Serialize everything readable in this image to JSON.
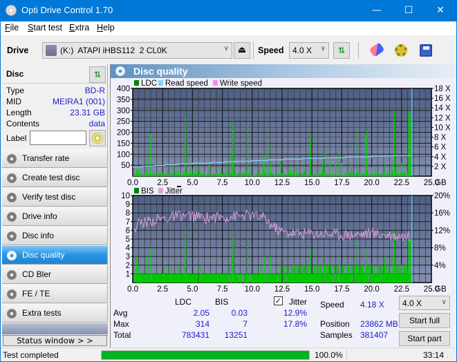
{
  "window": {
    "title": "Opti Drive Control 1.70",
    "minimize_label": "—",
    "maximize_label": "☐",
    "close_label": "✕"
  },
  "menu": {
    "items": [
      {
        "label": "File",
        "accel": "F",
        "rest": "ile"
      },
      {
        "label": "Start test",
        "accel": "S",
        "rest": "tart test"
      },
      {
        "label": "Extra",
        "accel": "E",
        "rest": "xtra"
      },
      {
        "label": "Help",
        "accel": "H",
        "rest": "elp"
      }
    ]
  },
  "toolbar": {
    "drive_label": "Drive",
    "drive_value": "(K:)  ATAPI iHBS112  2 CL0K",
    "speed_label": "Speed",
    "speed_value": "4.0 X",
    "icons": [
      "drive-icon",
      "eject-icon",
      "refresh-icon",
      "erase-icon",
      "settings-icon",
      "save-icon"
    ]
  },
  "disc": {
    "header": "Disc",
    "rows": [
      {
        "label": "Type",
        "value": "BD-R"
      },
      {
        "label": "MID",
        "value": "MEIRA1 (001)"
      },
      {
        "label": "Length",
        "value": "23.31 GB"
      },
      {
        "label": "Contents",
        "value": "data"
      }
    ],
    "label_field_label": "Label",
    "label_value": ""
  },
  "nav": {
    "items": [
      {
        "label": "Transfer rate",
        "active": false
      },
      {
        "label": "Create test disc",
        "active": false
      },
      {
        "label": "Verify test disc",
        "active": false
      },
      {
        "label": "Drive info",
        "active": false
      },
      {
        "label": "Disc info",
        "active": false
      },
      {
        "label": "Disc quality",
        "active": true
      },
      {
        "label": "CD Bler",
        "active": false
      },
      {
        "label": "FE / TE",
        "active": false
      },
      {
        "label": "Extra tests",
        "active": false
      }
    ],
    "status_window_label": "Status window > >"
  },
  "panel": {
    "title": "Disc quality"
  },
  "chart_data": [
    {
      "type": "bar",
      "title": "LDC / Read speed",
      "legend": [
        "LDC",
        "Read speed",
        "Write speed"
      ],
      "legend_colors": [
        "#008000",
        "#87cefa",
        "#ff88ee"
      ],
      "legend_placement": "top-left",
      "x_ticks": [
        "0.0",
        "2.5",
        "5.0",
        "7.5",
        "10.0",
        "12.5",
        "15.0",
        "17.5",
        "20.0",
        "22.5",
        "25.0"
      ],
      "x_unit": "GB",
      "xlim": [
        0,
        25
      ],
      "y_left_ticks": [
        "50",
        "100",
        "150",
        "200",
        "250",
        "300",
        "350",
        "400"
      ],
      "ylim_left": [
        0,
        400
      ],
      "y_right_ticks": [
        "2 X",
        "4 X",
        "6 X",
        "8 X",
        "10 X",
        "12 X",
        "14 X",
        "16 X",
        "18 X"
      ],
      "ylim_right": [
        0,
        18
      ],
      "grid": true,
      "end_marker_x": 23.31,
      "ldc_spikes": [
        [
          0.3,
          30
        ],
        [
          0.5,
          40
        ],
        [
          1.2,
          88
        ],
        [
          1.5,
          195
        ],
        [
          1.7,
          28
        ],
        [
          2.6,
          20
        ],
        [
          2.9,
          45
        ],
        [
          3.1,
          50
        ],
        [
          3.4,
          55
        ],
        [
          3.8,
          30
        ],
        [
          4.4,
          170
        ],
        [
          4.45,
          270
        ],
        [
          4.8,
          35
        ],
        [
          5.3,
          50
        ],
        [
          5.7,
          20
        ],
        [
          6.4,
          55
        ],
        [
          7.4,
          40
        ],
        [
          7.8,
          55
        ],
        [
          8.1,
          90
        ],
        [
          8.3,
          100
        ],
        [
          8.4,
          240
        ],
        [
          8.45,
          250
        ],
        [
          9.6,
          240
        ],
        [
          9.8,
          40
        ],
        [
          10.6,
          60
        ],
        [
          10.9,
          50
        ],
        [
          11.0,
          100
        ],
        [
          11.3,
          175
        ],
        [
          11.5,
          60
        ],
        [
          12.4,
          70
        ],
        [
          13.2,
          40
        ],
        [
          13.7,
          45
        ],
        [
          14.8,
          70
        ],
        [
          14.9,
          190
        ],
        [
          15.3,
          40
        ],
        [
          15.9,
          60
        ],
        [
          16.1,
          125
        ],
        [
          16.5,
          80
        ],
        [
          17.0,
          95
        ],
        [
          17.3,
          100
        ],
        [
          17.5,
          60
        ],
        [
          18.3,
          60
        ],
        [
          18.8,
          200
        ],
        [
          19.5,
          190
        ],
        [
          19.6,
          210
        ],
        [
          20.0,
          40
        ],
        [
          20.3,
          40
        ],
        [
          21.1,
          50
        ],
        [
          21.7,
          60
        ],
        [
          21.9,
          300
        ],
        [
          22.2,
          60
        ],
        [
          22.5,
          60
        ],
        [
          22.8,
          60
        ],
        [
          23.1,
          300
        ],
        [
          23.2,
          290
        ],
        [
          23.25,
          270
        ]
      ],
      "ldc_baseline": 8,
      "read_speed_steps": [
        [
          0,
          1.9
        ],
        [
          0.8,
          2.05
        ],
        [
          1.8,
          2.2
        ],
        [
          2.7,
          2.35
        ],
        [
          3.8,
          2.5
        ],
        [
          5.0,
          2.65
        ],
        [
          6.5,
          2.8
        ],
        [
          7.7,
          2.95
        ],
        [
          8.5,
          3.05
        ],
        [
          10.0,
          3.2
        ],
        [
          11.3,
          3.35
        ],
        [
          12.6,
          3.5
        ],
        [
          14.2,
          3.65
        ],
        [
          16.0,
          3.8
        ],
        [
          17.8,
          3.95
        ],
        [
          20.0,
          4.1
        ],
        [
          21.8,
          4.18
        ],
        [
          23.31,
          4.18
        ]
      ]
    },
    {
      "type": "bar",
      "title": "BIS / Jitter",
      "legend": [
        "BIS",
        "Jitter"
      ],
      "legend_colors": [
        "#008000",
        "#dda0dd"
      ],
      "legend_placement": "top-left",
      "x_ticks": [
        "0.0",
        "2.5",
        "5.0",
        "7.5",
        "10.0",
        "12.5",
        "15.0",
        "17.5",
        "20.0",
        "22.5",
        "25.0"
      ],
      "x_unit": "GB",
      "xlim": [
        0,
        25
      ],
      "y_left_ticks": [
        "1",
        "2",
        "3",
        "4",
        "5",
        "6",
        "7",
        "8",
        "9",
        "10"
      ],
      "ylim_left": [
        0,
        10
      ],
      "y_right_ticks": [
        "4%",
        "8%",
        "12%",
        "16%",
        "20%"
      ],
      "ylim_right": [
        0,
        20
      ],
      "grid": true,
      "end_marker_x": 23.31,
      "bis_spikes": [
        [
          0.3,
          3
        ],
        [
          0.5,
          2
        ],
        [
          1.2,
          3
        ],
        [
          1.5,
          4
        ],
        [
          2.6,
          2
        ],
        [
          3.2,
          2
        ],
        [
          3.8,
          2
        ],
        [
          4.4,
          4
        ],
        [
          4.45,
          6
        ],
        [
          5.7,
          2
        ],
        [
          8.1,
          2
        ],
        [
          8.3,
          3
        ],
        [
          8.4,
          5
        ],
        [
          8.45,
          6
        ],
        [
          9.6,
          5
        ],
        [
          10.7,
          2
        ],
        [
          11.0,
          3
        ],
        [
          11.5,
          3
        ],
        [
          12.4,
          2
        ],
        [
          14.9,
          4
        ],
        [
          16.1,
          3
        ],
        [
          17.3,
          3
        ],
        [
          18.8,
          5
        ],
        [
          19.5,
          4
        ],
        [
          21.1,
          3
        ],
        [
          21.7,
          3
        ],
        [
          21.9,
          6
        ],
        [
          23.1,
          5
        ],
        [
          23.25,
          5
        ]
      ],
      "jitter_profile": [
        [
          0,
          12.2
        ],
        [
          0.5,
          13.6
        ],
        [
          1,
          13.8
        ],
        [
          2,
          14.5
        ],
        [
          3,
          14.8
        ],
        [
          4,
          15.4
        ],
        [
          5,
          15.2
        ],
        [
          6,
          14.9
        ],
        [
          7,
          15.0
        ],
        [
          8,
          15.1
        ],
        [
          9,
          15.3
        ],
        [
          10,
          15.4
        ],
        [
          11,
          14.8
        ],
        [
          11.7,
          13.0
        ],
        [
          12.5,
          11.6
        ],
        [
          14,
          11.3
        ],
        [
          16,
          11.3
        ],
        [
          18,
          11.0
        ],
        [
          20,
          11.3
        ],
        [
          22,
          10.8
        ],
        [
          23.31,
          10.6
        ]
      ]
    }
  ],
  "stats": {
    "col_headers": [
      "LDC",
      "BIS"
    ],
    "jitter_label": "Jitter",
    "jitter_checked": true,
    "rows": [
      {
        "label": "Avg",
        "ldc": "2.05",
        "bis": "0.03",
        "jitter": "12.9%"
      },
      {
        "label": "Max",
        "ldc": "314",
        "bis": "7",
        "jitter": "17.8%"
      },
      {
        "label": "Total",
        "ldc": "783431",
        "bis": "13251",
        "jitter": ""
      }
    ],
    "speed_label": "Speed",
    "speed_value": "4.18 X",
    "position_label": "Position",
    "position_value": "23862 MB",
    "samples_label": "Samples",
    "samples_value": "381407",
    "speed_select": "4.0 X",
    "start_full_label": "Start full",
    "start_part_label": "Start part"
  },
  "statusbar": {
    "status_text": "Test completed",
    "progress_fraction": 1.0,
    "progress_text": "100.0%",
    "elapsed": "33:14"
  }
}
